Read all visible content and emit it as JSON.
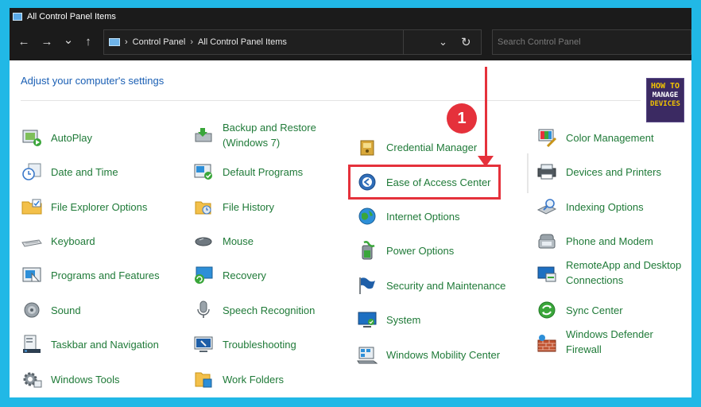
{
  "window": {
    "title": "All Control Panel Items"
  },
  "nav": {
    "back": "←",
    "forward": "→",
    "recent": "⌄",
    "up": "↑",
    "breadcrumb": [
      "Control Panel",
      "All Control Panel Items"
    ],
    "separator": "›",
    "dropdown": "⌄",
    "refresh": "↻",
    "search_placeholder": "Search Control Panel"
  },
  "heading": "Adjust your computer's settings",
  "logo": {
    "line1": "HOW TO",
    "line2": "MANAGE",
    "line3": "DEVICES"
  },
  "annotation": {
    "step": "1"
  },
  "colors": {
    "link_green": "#1f7a38",
    "heading_blue": "#1a5fb4",
    "accent_red": "#e5313b",
    "frame_cyan": "#21b8e6"
  },
  "columns": [
    [
      {
        "label": "AutoPlay",
        "icon": "autoplay-icon"
      },
      {
        "label": "Date and Time",
        "icon": "clock-icon"
      },
      {
        "label": "File Explorer Options",
        "icon": "folder-icon"
      },
      {
        "label": "Keyboard",
        "icon": "keyboard-icon"
      },
      {
        "label": "Programs and Features",
        "icon": "programs-icon"
      },
      {
        "label": "Sound",
        "icon": "speaker-icon"
      },
      {
        "label": "Taskbar and Navigation",
        "icon": "taskbar-icon"
      },
      {
        "label": "Windows Tools",
        "icon": "gear-icon"
      }
    ],
    [
      {
        "label": "Backup and Restore",
        "label2": "(Windows 7)",
        "icon": "backup-icon"
      },
      {
        "label": "Default Programs",
        "icon": "default-programs-icon"
      },
      {
        "label": "File History",
        "icon": "file-history-icon"
      },
      {
        "label": "Mouse",
        "icon": "mouse-icon"
      },
      {
        "label": "Recovery",
        "icon": "recovery-icon"
      },
      {
        "label": "Speech Recognition",
        "icon": "microphone-icon"
      },
      {
        "label": "Troubleshooting",
        "icon": "troubleshoot-icon"
      },
      {
        "label": "Work Folders",
        "icon": "work-folders-icon"
      }
    ],
    [
      {
        "label": "Credential Manager",
        "icon": "credential-icon"
      },
      {
        "label": "Ease of Access Center",
        "icon": "ease-of-access-icon"
      },
      {
        "label": "Internet Options",
        "icon": "globe-icon"
      },
      {
        "label": "Power Options",
        "icon": "power-icon"
      },
      {
        "label": "Security and Maintenance",
        "icon": "flag-icon"
      },
      {
        "label": "System",
        "icon": "system-icon"
      },
      {
        "label": "Windows Mobility Center",
        "icon": "mobility-icon"
      }
    ],
    [
      {
        "label": "Color Management",
        "icon": "color-icon"
      },
      {
        "label": "Devices and Printers",
        "icon": "printer-icon"
      },
      {
        "label": "Indexing Options",
        "icon": "indexing-icon"
      },
      {
        "label": "Phone and Modem",
        "icon": "phone-icon"
      },
      {
        "label": "RemoteApp and Desktop",
        "label2": "Connections",
        "icon": "remote-icon"
      },
      {
        "label": "Sync Center",
        "icon": "sync-icon"
      },
      {
        "label": "Windows Defender",
        "label2": "Firewall",
        "icon": "firewall-icon"
      }
    ]
  ]
}
